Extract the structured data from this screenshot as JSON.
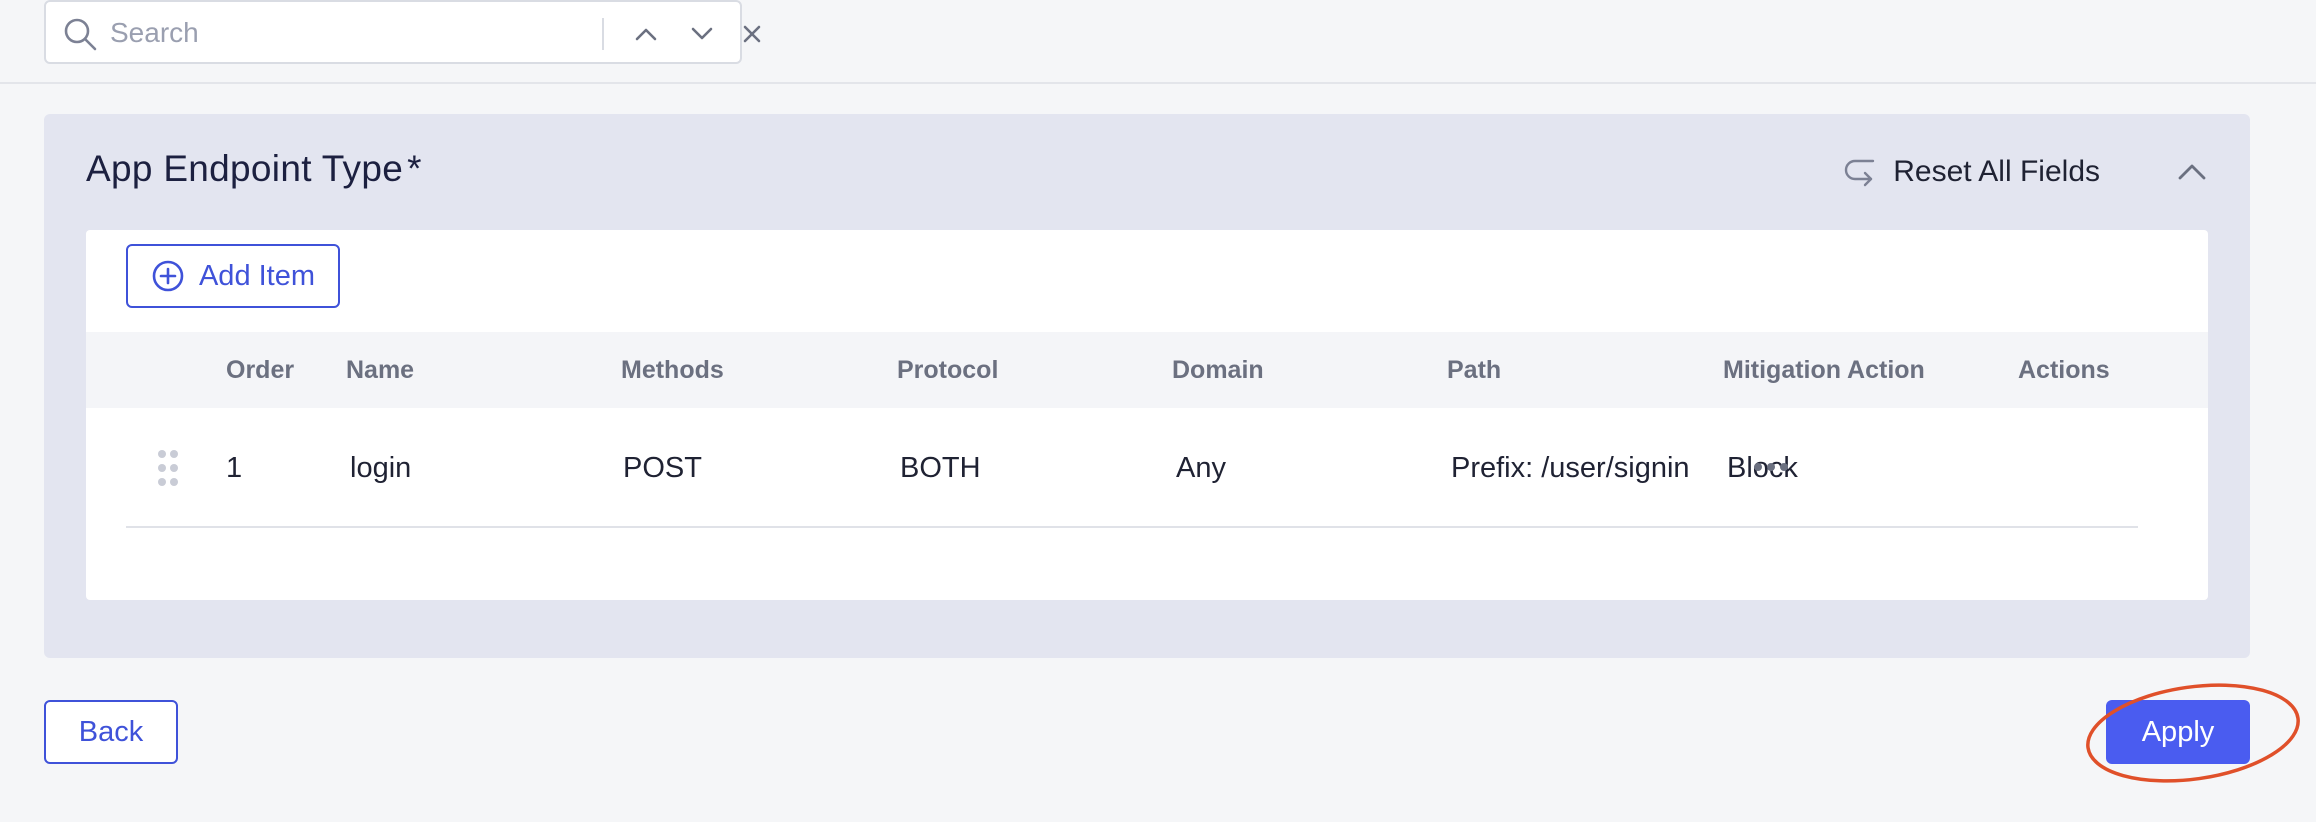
{
  "search": {
    "placeholder": "Search",
    "value": ""
  },
  "panel": {
    "title": "App Endpoint Type",
    "required_marker": "*",
    "reset_label": "Reset All Fields"
  },
  "table": {
    "add_item_label": "Add Item",
    "columns": [
      "Order",
      "Name",
      "Methods",
      "Protocol",
      "Domain",
      "Path",
      "Mitigation Action",
      "Actions"
    ],
    "rows": [
      {
        "order": "1",
        "name": "login",
        "methods": "POST",
        "protocol": "BOTH",
        "domain": "Any",
        "path": "Prefix: /user/signin",
        "mitigation_action": "Block"
      }
    ]
  },
  "footer": {
    "back_label": "Back",
    "apply_label": "Apply"
  },
  "colors": {
    "accent": "#3f52d9",
    "primary_button": "#4a5cf0",
    "panel_background": "#e3e5f0",
    "annotation_circle": "#e0502a"
  },
  "icons": {
    "search": "search-icon",
    "prev": "chevron-up-icon",
    "next": "chevron-down-icon",
    "clear": "close-icon",
    "reset": "undo-arrow-icon",
    "collapse": "chevron-up-icon",
    "add": "plus-circle-icon",
    "drag": "drag-handle-icon",
    "more": "more-horizontal-icon"
  }
}
